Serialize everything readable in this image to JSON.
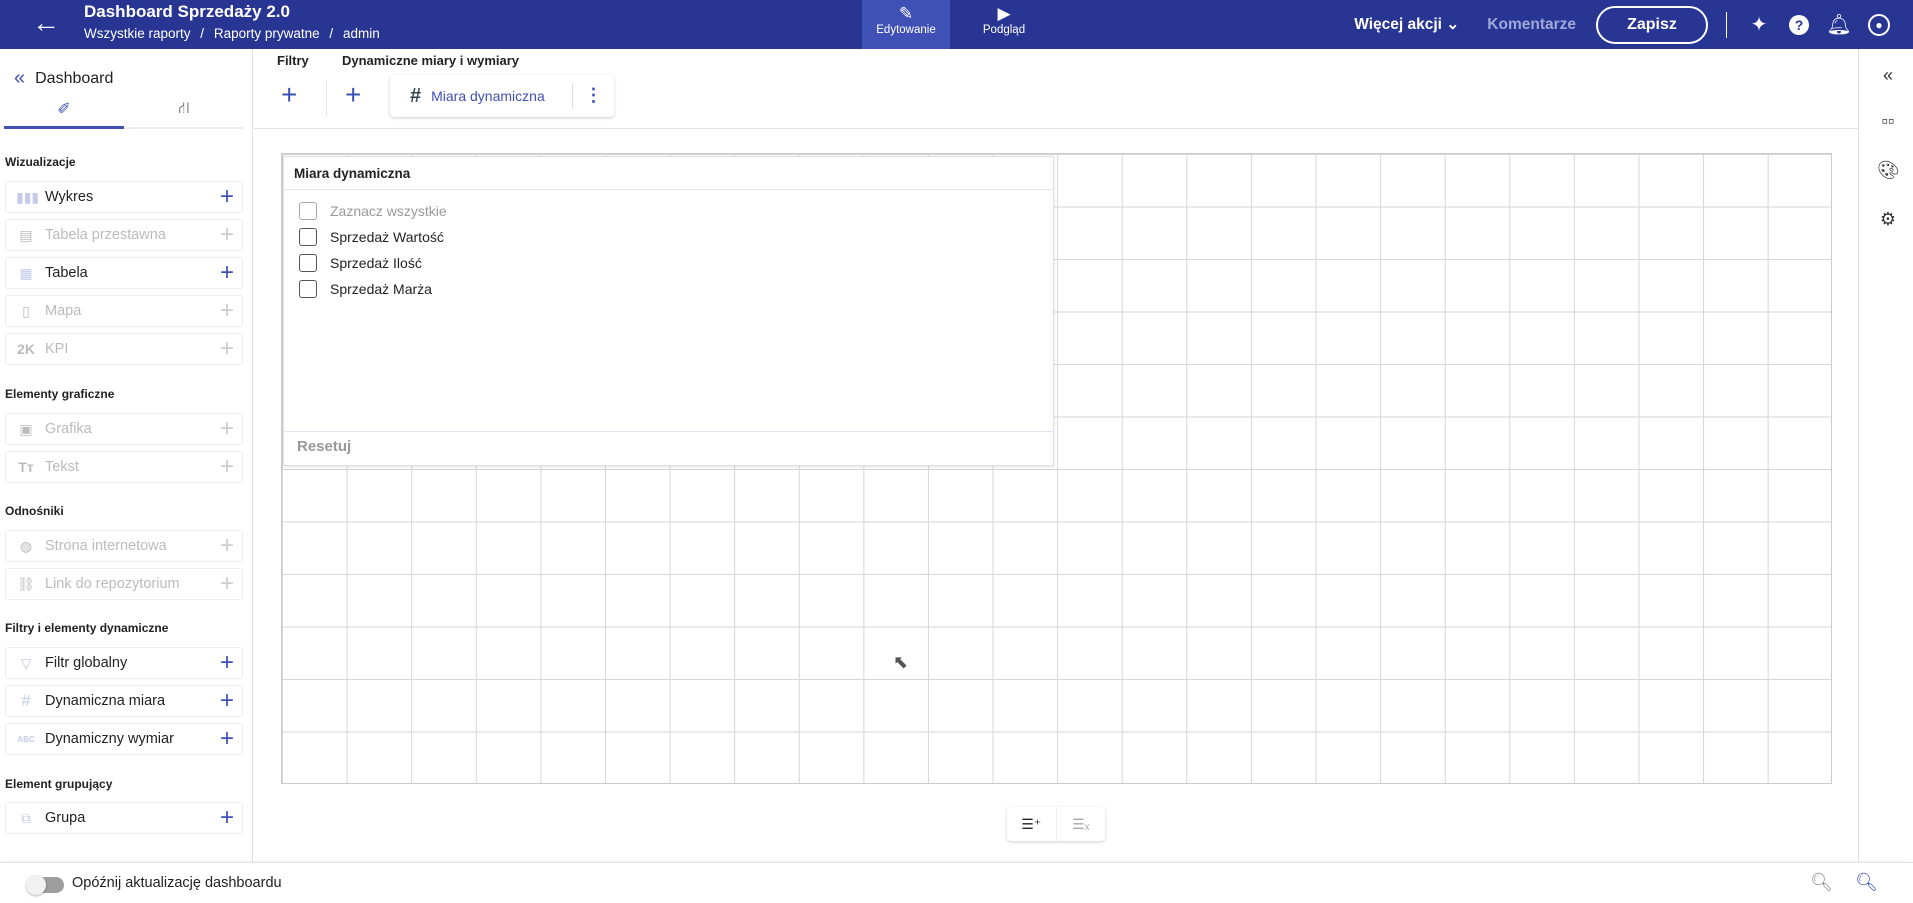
{
  "header": {
    "title": "Dashboard Sprzedaży 2.0",
    "breadcrumbs": [
      "Wszystkie raporty",
      "/",
      "Raporty prywatne",
      "/",
      "admin"
    ],
    "modes": [
      {
        "label": "Edytowanie",
        "active": true
      },
      {
        "label": "Podgląd",
        "active": false
      }
    ],
    "more_actions": "Więcej akcji",
    "comments": "Komentarze",
    "save": "Zapisz"
  },
  "sidebar": {
    "title": "Dashboard",
    "sections": [
      {
        "label": "Wizualizacje",
        "items": [
          {
            "label": "Wykres",
            "enabled": true
          },
          {
            "label": "Tabela przestawna",
            "enabled": false
          },
          {
            "label": "Tabela",
            "enabled": true
          },
          {
            "label": "Mapa",
            "enabled": false
          },
          {
            "label": "KPI",
            "enabled": false
          }
        ]
      },
      {
        "label": "Elementy graficzne",
        "items": [
          {
            "label": "Grafika",
            "enabled": false
          },
          {
            "label": "Tekst",
            "enabled": false
          }
        ]
      },
      {
        "label": "Odnośniki",
        "items": [
          {
            "label": "Strona internetowa",
            "enabled": false
          },
          {
            "label": "Link do repozytorium",
            "enabled": false
          }
        ]
      },
      {
        "label": "Filtry i elementy dynamiczne",
        "items": [
          {
            "label": "Filtr globalny",
            "enabled": true
          },
          {
            "label": "Dynamiczna miara",
            "enabled": true
          },
          {
            "label": "Dynamiczny wymiar",
            "enabled": true
          }
        ]
      },
      {
        "label": "Element grupujący",
        "items": [
          {
            "label": "Grupa",
            "enabled": true
          }
        ]
      }
    ]
  },
  "toolbar": {
    "filters_label": "Filtry",
    "dynamic_label": "Dynamiczne miary i wymiary",
    "chip_label": "Miara dynamiczna"
  },
  "widget": {
    "title": "Miara dynamiczna",
    "select_all": "Zaznacz wszystkie",
    "options": [
      "Sprzedaż Wartość",
      "Sprzedaż Ilość",
      "Sprzedaż Marża"
    ],
    "reset": "Resetuj"
  },
  "footer": {
    "delay_toggle_label": "Opóźnij aktualizację dashboardu",
    "delay_toggle_on": false
  },
  "colors": {
    "header": "#283593",
    "accent": "#3f51b5"
  }
}
